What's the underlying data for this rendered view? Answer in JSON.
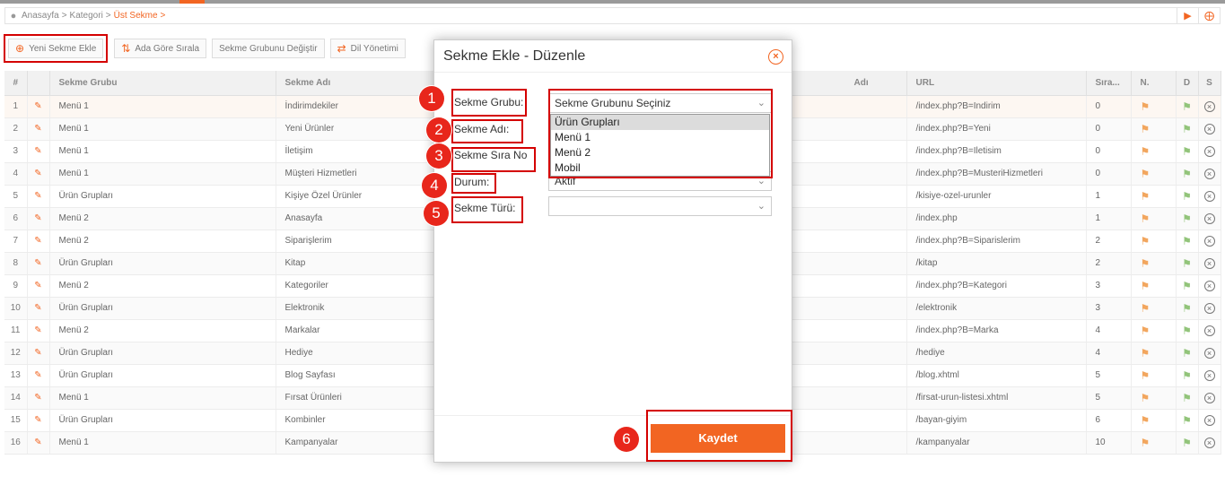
{
  "breadcrumb": {
    "items": [
      "Anasayfa",
      "Kategori",
      "Üst Sekme"
    ],
    "separator": ">"
  },
  "toolbar": {
    "add_label": "Yeni Sekme Ekle",
    "sort_label": "Ada Göre Sırala",
    "change_group_label": "Sekme Grubunu Değiştir",
    "language_label": "Dil Yönetimi"
  },
  "table": {
    "headers": [
      "#",
      "",
      "Sekme Grubu",
      "Sekme Adı",
      "Adı",
      "URL",
      "Sıra...",
      "N.",
      "D",
      "S"
    ],
    "rows": [
      {
        "no": "1",
        "group": "Menü 1",
        "name": "İndirimdekiler",
        "url": "/index.php?B=Indirim",
        "order": "0"
      },
      {
        "no": "2",
        "group": "Menü 1",
        "name": "Yeni Ürünler",
        "url": "/index.php?B=Yeni",
        "order": "0"
      },
      {
        "no": "3",
        "group": "Menü 1",
        "name": "İletişim",
        "url": "/index.php?B=Iletisim",
        "order": "0"
      },
      {
        "no": "4",
        "group": "Menü 1",
        "name": "Müşteri Hizmetleri",
        "url": "/index.php?B=MusteriHizmetleri",
        "order": "0"
      },
      {
        "no": "5",
        "group": "Ürün Grupları",
        "name": "Kişiye Özel Ürünler",
        "url": "/kisiye-ozel-urunler",
        "order": "1"
      },
      {
        "no": "6",
        "group": "Menü 2",
        "name": "Anasayfa",
        "url": "/index.php",
        "order": "1"
      },
      {
        "no": "7",
        "group": "Menü 2",
        "name": "Siparişlerim",
        "url": "/index.php?B=Siparislerim",
        "order": "2"
      },
      {
        "no": "8",
        "group": "Ürün Grupları",
        "name": "Kitap",
        "url": "/kitap",
        "order": "2"
      },
      {
        "no": "9",
        "group": "Menü 2",
        "name": "Kategoriler",
        "url": "/index.php?B=Kategori",
        "order": "3"
      },
      {
        "no": "10",
        "group": "Ürün Grupları",
        "name": "Elektronik",
        "url": "/elektronik",
        "order": "3"
      },
      {
        "no": "11",
        "group": "Menü 2",
        "name": "Markalar",
        "url": "/index.php?B=Marka",
        "order": "4"
      },
      {
        "no": "12",
        "group": "Ürün Grupları",
        "name": "Hediye",
        "url": "/hediye",
        "order": "4"
      },
      {
        "no": "13",
        "group": "Ürün Grupları",
        "name": "Blog Sayfası",
        "url": "/blog.xhtml",
        "order": "5"
      },
      {
        "no": "14",
        "group": "Menü 1",
        "name": "Fırsat Ürünleri",
        "url": "/firsat-urun-listesi.xhtml",
        "order": "5"
      },
      {
        "no": "15",
        "group": "Ürün Grupları",
        "name": "Kombinler",
        "url": "/bayan-giyim",
        "order": "6"
      },
      {
        "no": "16",
        "group": "Menü 1",
        "name": "Kampanyalar",
        "url": "/kampanyalar",
        "order": "10"
      }
    ]
  },
  "modal": {
    "title": "Sekme Ekle - Düzenle",
    "close_glyph": "×",
    "fields": {
      "group_label": "Sekme Grubu:",
      "name_label": "Sekme Adı:",
      "order_label": "Sekme Sıra No",
      "status_label": "Durum:",
      "type_label": "Sekme Türü:"
    },
    "group_select_value": "Sekme Grubunu Seçiniz",
    "group_options": [
      "Ürün Grupları",
      "Menü 1",
      "Menü 2",
      "Mobil"
    ],
    "status_value": "Aktif",
    "type_value": "",
    "save_label": "Kaydet"
  },
  "markers": [
    "1",
    "2",
    "3",
    "4",
    "5",
    "6"
  ],
  "colors": {
    "accent": "#f26522",
    "annotation": "#d40000",
    "marker": "#e8261b"
  },
  "icons": {
    "pin": "location-pin-icon",
    "add": "plus-circle-icon",
    "sort": "sort-az-icon",
    "language": "translate-icon",
    "edit": "pencil-icon",
    "flag": "flag-icon",
    "delete": "x-circle-icon"
  }
}
